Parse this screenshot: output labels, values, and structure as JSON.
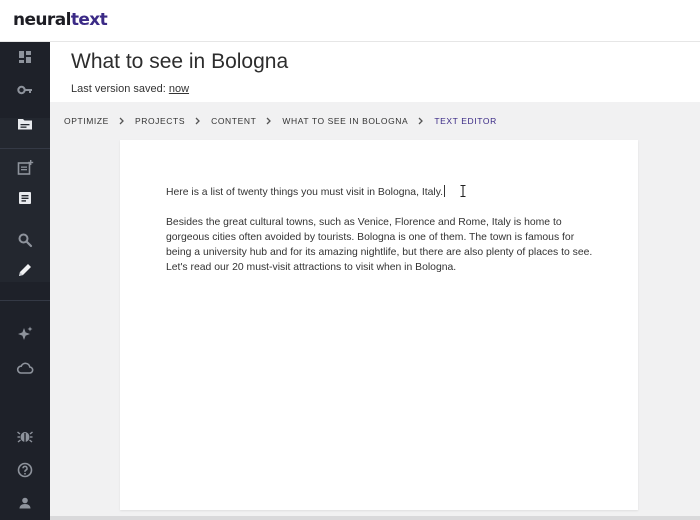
{
  "app": {
    "logo_part1": "neural",
    "logo_part2": "text",
    "brand_color": "#3b2a86"
  },
  "sidebar": {
    "items": [
      {
        "icon": "dashboard-icon"
      },
      {
        "icon": "key-icon"
      },
      {
        "icon": "folder-icon"
      },
      {
        "icon": "add-document-icon"
      },
      {
        "icon": "document-icon"
      },
      {
        "icon": "search-icon"
      },
      {
        "icon": "pencil-icon",
        "active": true
      },
      {
        "icon": "sparkles-icon"
      },
      {
        "icon": "cloud-icon"
      },
      {
        "icon": "bug-icon"
      },
      {
        "icon": "help-icon"
      },
      {
        "icon": "user-icon"
      }
    ]
  },
  "header": {
    "title": "What to see in Bologna",
    "saved_label": "Last version saved:",
    "saved_value": "now"
  },
  "breadcrumb": [
    "OPTIMIZE",
    "PROJECTS",
    "CONTENT",
    "WHAT TO SEE IN BOLOGNA",
    "TEXT EDITOR"
  ],
  "editor": {
    "paragraphs": [
      "Here is a list of twenty things you must visit in Bologna, Italy.",
      "Besides the great cultural towns, such as Venice, Florence and Rome, Italy is home to gorgeous cities often avoided by tourists. Bologna is one of them. The town is famous for being a university hub and for its amazing nightlife, but there are also plenty of places to see. Let's read our 20 must-visit attractions to visit when in Bologna."
    ]
  }
}
